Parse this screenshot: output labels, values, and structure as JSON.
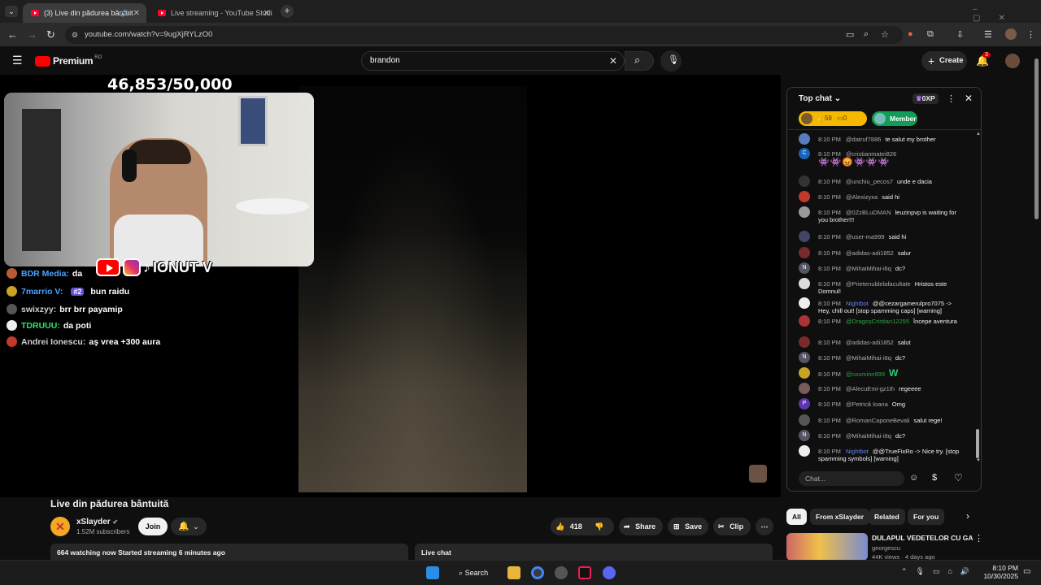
{
  "browser": {
    "tabs": [
      {
        "title": "(3) Live din pădurea bântuit",
        "active": true
      },
      {
        "title": "Live streaming - YouTube Studi",
        "active": false
      }
    ],
    "url": "youtube.com/watch?v=9ugXjRYLzO0"
  },
  "masthead": {
    "logo": "Premium",
    "region": "RO",
    "search_value": "brandon",
    "create_label": "Create",
    "notif_count": "3"
  },
  "stream_overlay": {
    "goal": "46,853/50,000",
    "handle": "IONUT V",
    "chat": [
      {
        "name": "BDR Media:",
        "msg": "da",
        "name_color": "#4aa3ff",
        "av_color": "#b85c38"
      },
      {
        "name": "7marrio V:",
        "badge": "#2",
        "msg": "bun raidu",
        "name_color": "#4aa3ff",
        "av_color": "#c9a227"
      },
      {
        "name": "swixzyy:",
        "msg": "brr brr payamip",
        "name_color": "#cfcfcf",
        "av_color": "#555"
      },
      {
        "name": "TDRUUU:",
        "msg": "da poti",
        "name_color": "#2ee66b",
        "av_color": "#eee"
      },
      {
        "name": "Andrei Ionescu:",
        "msg": "aş vrea +300 aura",
        "name_color": "#cfcfcf",
        "av_color": "#c0392b"
      }
    ]
  },
  "video": {
    "title": "Live din pădurea bântuită",
    "channel": "xSlayder",
    "subscribers": "1.52M subscribers",
    "join_label": "Join",
    "likes": "418",
    "share_label": "Share",
    "save_label": "Save",
    "clip_label": "Clip",
    "meta": "664 watching now  Started streaming 6 minutes ago",
    "live_chat_label": "Live chat"
  },
  "chat_panel": {
    "title": "Top chat",
    "xp": "0XP",
    "ticker_likes": "59",
    "ticker_msgs": "0",
    "member_label": "Member",
    "input_placeholder": "Chat...",
    "messages": [
      {
        "time": "8:10 PM",
        "author": "@datruf7886",
        "text": "te salut my brother",
        "av": "#5b7bbd"
      },
      {
        "time": "8:10 PM",
        "author": "@cristianmatei826",
        "text": "",
        "av": "#1565c0",
        "av_letter": "C"
      },
      {
        "time": "8:10 PM",
        "author": "@unchiu_pecos7",
        "text": "unde e dacia",
        "av": "#333"
      },
      {
        "time": "8:10 PM",
        "author": "@Alexizyxa",
        "text": "said hi",
        "av": "#c0392b"
      },
      {
        "time": "8:10 PM",
        "author": "@0ZzBLuDMAN",
        "text": "leuzinpvp is waiting for you brother!!!",
        "av": "#999"
      },
      {
        "time": "8:10 PM",
        "author": "@user-ma999",
        "text": "said hi",
        "av": "#446"
      },
      {
        "time": "8:10 PM",
        "author": "@adidas-adi1852",
        "text": "salur",
        "av": "#7a2a2a"
      },
      {
        "time": "8:10 PM",
        "author": "@MihaiMihai-i6q",
        "text": "dc?",
        "av": "#556",
        "av_letter": "N"
      },
      {
        "time": "8:10 PM",
        "author": "@Prietenuldelafacultate",
        "text": "Hristos este Domnul!",
        "av": "#ddd"
      },
      {
        "time": "8:10 PM",
        "author": "Nightbot",
        "text": "@@cezargamerulpro7075 -> Hey, chill out! [stop spamming caps] [warning]",
        "av": "#eee"
      },
      {
        "time": "8:10 PM",
        "author": "@DragoșCristian12255",
        "text": "Începe aventura",
        "av": "#a33"
      },
      {
        "time": "8:10 PM",
        "author": "@adidas-adi1852",
        "text": "salut",
        "av": "#7a2a2a"
      },
      {
        "time": "8:10 PM",
        "author": "@MihaiMihai-i6q",
        "text": "dc?",
        "av": "#556",
        "av_letter": "N"
      },
      {
        "time": "8:10 PM",
        "author": "@cosminn999",
        "text": "W",
        "av": "#c9a227"
      },
      {
        "time": "8:10 PM",
        "author": "@AlecuEmi-gz1th",
        "text": "regeeee",
        "av": "#7a5a5a"
      },
      {
        "time": "8:10 PM",
        "author": "@Petrică Ioana",
        "text": "Omg",
        "av": "#5e35b1",
        "av_letter": "P"
      },
      {
        "time": "8:10 PM",
        "author": "@RomanCaponeBevali",
        "text": "salut rege!",
        "av": "#555"
      },
      {
        "time": "8:10 PM",
        "author": "@MihaiMihai-i6q",
        "text": "dc?",
        "av": "#556",
        "av_letter": "N"
      },
      {
        "time": "8:10 PM",
        "author": "Nightbot",
        "text": "@@TrueFixRo -> Nice try. [stop spamming symbols] [warning]",
        "av": "#eee"
      }
    ]
  },
  "related": {
    "tabs": [
      "All",
      "From xSlayder",
      "Related",
      "For you"
    ],
    "video_title": "DULAPUL VEDETELOR CU GAMI",
    "video_channel": "georgescu",
    "video_meta": "44K views · 4 days ago"
  },
  "taskbar": {
    "search_label": "Search",
    "time": "8:10 PM",
    "date": "10/30/2025"
  }
}
